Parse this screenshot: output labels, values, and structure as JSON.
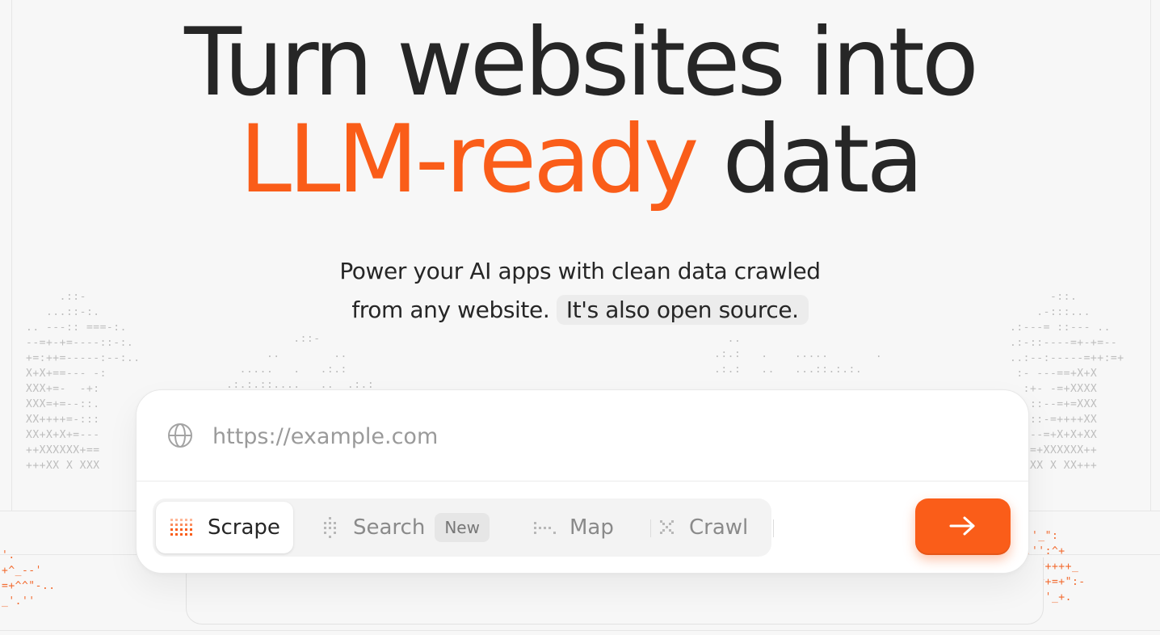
{
  "hero": {
    "title_line1": "Turn websites into",
    "title_accent": "LLM-ready",
    "title_rest": "data",
    "subtitle_line1": "Power your AI apps with clean data crawled",
    "subtitle_line2": "from any website.",
    "open_source_label": "It's also open source."
  },
  "url_field": {
    "placeholder": "https://example.com",
    "value": ""
  },
  "modes": [
    {
      "label": "Scrape",
      "active": true
    },
    {
      "label": "Search",
      "badge": "New",
      "active": false
    },
    {
      "label": "Map",
      "active": false
    },
    {
      "label": "Crawl",
      "active": false
    }
  ],
  "submit": {
    "icon": "arrow-right-icon",
    "aria": "Submit"
  },
  "colors": {
    "accent": "#fa5d19",
    "text": "#262626",
    "muted": "#8a8a8a",
    "background": "#f7f7f7"
  },
  "decor": {
    "ascii_left_top": "     .::-\n   ...::-:.\n.. ---:: ===-:.\n--=+-+=----::-:.\n+=:++=-----:--:..\nX+X+==--- -:\nXXX+=-  -+:\nXXX=+=--::.\nXX++++=-:::\nXX+X+X+=---\n++XXXXXX+==\n+++XX X XXX",
    "ascii_right_top": "      -::.\n    .-:::...\n.:---= ::--- ..\n.:-::----=+-+=--\n..:--:-----=++:=+\n :- ---==+X+X\n  :+- -=+XXXX\n  .::--=+=XXX\n  :::-=++++XX\n  ---=+X+X+XX\n  ==+XXXXXX++\n  XXX X XX+++",
    "ascii_mid_left": "          .::-\n      ..        ..\n  .....   .   .:.:\n.:.:.::....   ..  .:.:",
    "ascii_mid_right": "  ..\n.:.:   .    .....       .\n.:.:   ..   ...::.:.:.",
    "ascii_orange_left": "'.\n+^_--'\n=+^^\"-..\n_'.''",
    "ascii_orange_right": "   '_\":\n  .'':^+\n'--,^++++_\n.-\"^^+=+\":-\n  ''.'_+."
  }
}
